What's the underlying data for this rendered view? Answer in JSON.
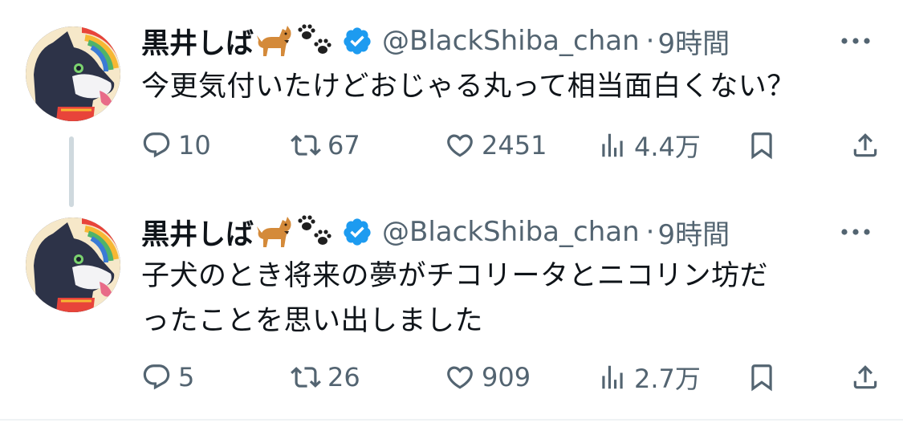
{
  "tweets": [
    {
      "author": {
        "name": "黒井しば",
        "handle": "@BlackShiba_chan",
        "separator": "·",
        "time": "9時間"
      },
      "text": "今更気付いたけどおじゃる丸って相当面白くない？",
      "metrics": {
        "replies": "10",
        "retweets": "67",
        "likes": "2451",
        "views": "4.4万"
      }
    },
    {
      "author": {
        "name": "黒井しば",
        "handle": "@BlackShiba_chan",
        "separator": "·",
        "time": "9時間"
      },
      "text_line1": "子犬のとき将来の夢がチコリータとニコリン坊だ",
      "text_line2": "ったことを思い出しました",
      "metrics": {
        "replies": "5",
        "retweets": "26",
        "likes": "909",
        "views": "2.7万"
      }
    }
  ],
  "icons": {
    "emoji_1": "dog-emoji-icon",
    "emoji_2": "paw-prints-icon",
    "badge": "verified-badge-icon",
    "more": "more-icon",
    "reply": "reply-icon",
    "retweet": "retweet-icon",
    "like": "heart-icon",
    "views": "views-icon",
    "bookmark": "bookmark-icon",
    "share": "share-icon"
  },
  "colors": {
    "text": "#0f1419",
    "secondary": "#536471",
    "verified": "#1d9bf0",
    "thread_line": "#cfd9de"
  }
}
